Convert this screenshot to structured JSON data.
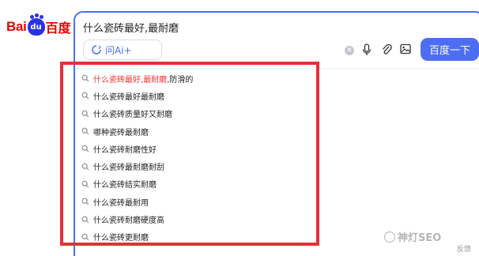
{
  "logo": {
    "part1": "Bai",
    "part2": "du",
    "part3": "百度"
  },
  "search": {
    "query": "什么瓷砖最好,最耐磨",
    "ai_label": "问Ai+",
    "submit_label": "百度一下"
  },
  "suggestions": [
    {
      "highlight": "什么瓷砖最好,最耐磨",
      "rest": ",防滑的"
    },
    {
      "highlight": "",
      "rest": "什么瓷砖最好最耐磨"
    },
    {
      "highlight": "",
      "rest": "什么瓷砖质量好又耐磨"
    },
    {
      "highlight": "",
      "rest": "哪种瓷砖最耐磨"
    },
    {
      "highlight": "",
      "rest": "什么瓷砖耐磨性好"
    },
    {
      "highlight": "",
      "rest": "什么瓷砖最耐磨耐刮"
    },
    {
      "highlight": "",
      "rest": "什么瓷砖结实耐磨"
    },
    {
      "highlight": "",
      "rest": "什么瓷砖最耐用"
    },
    {
      "highlight": "",
      "rest": "什么瓷砖耐磨硬度高"
    },
    {
      "highlight": "",
      "rest": "什么瓷砖更耐磨"
    }
  ],
  "watermark": "神灯SEO",
  "feedback": "反馈",
  "colors": {
    "accent": "#4e6ef2",
    "highlight": "#f73131",
    "frame": "#e53035",
    "logo_red": "#e10601"
  }
}
